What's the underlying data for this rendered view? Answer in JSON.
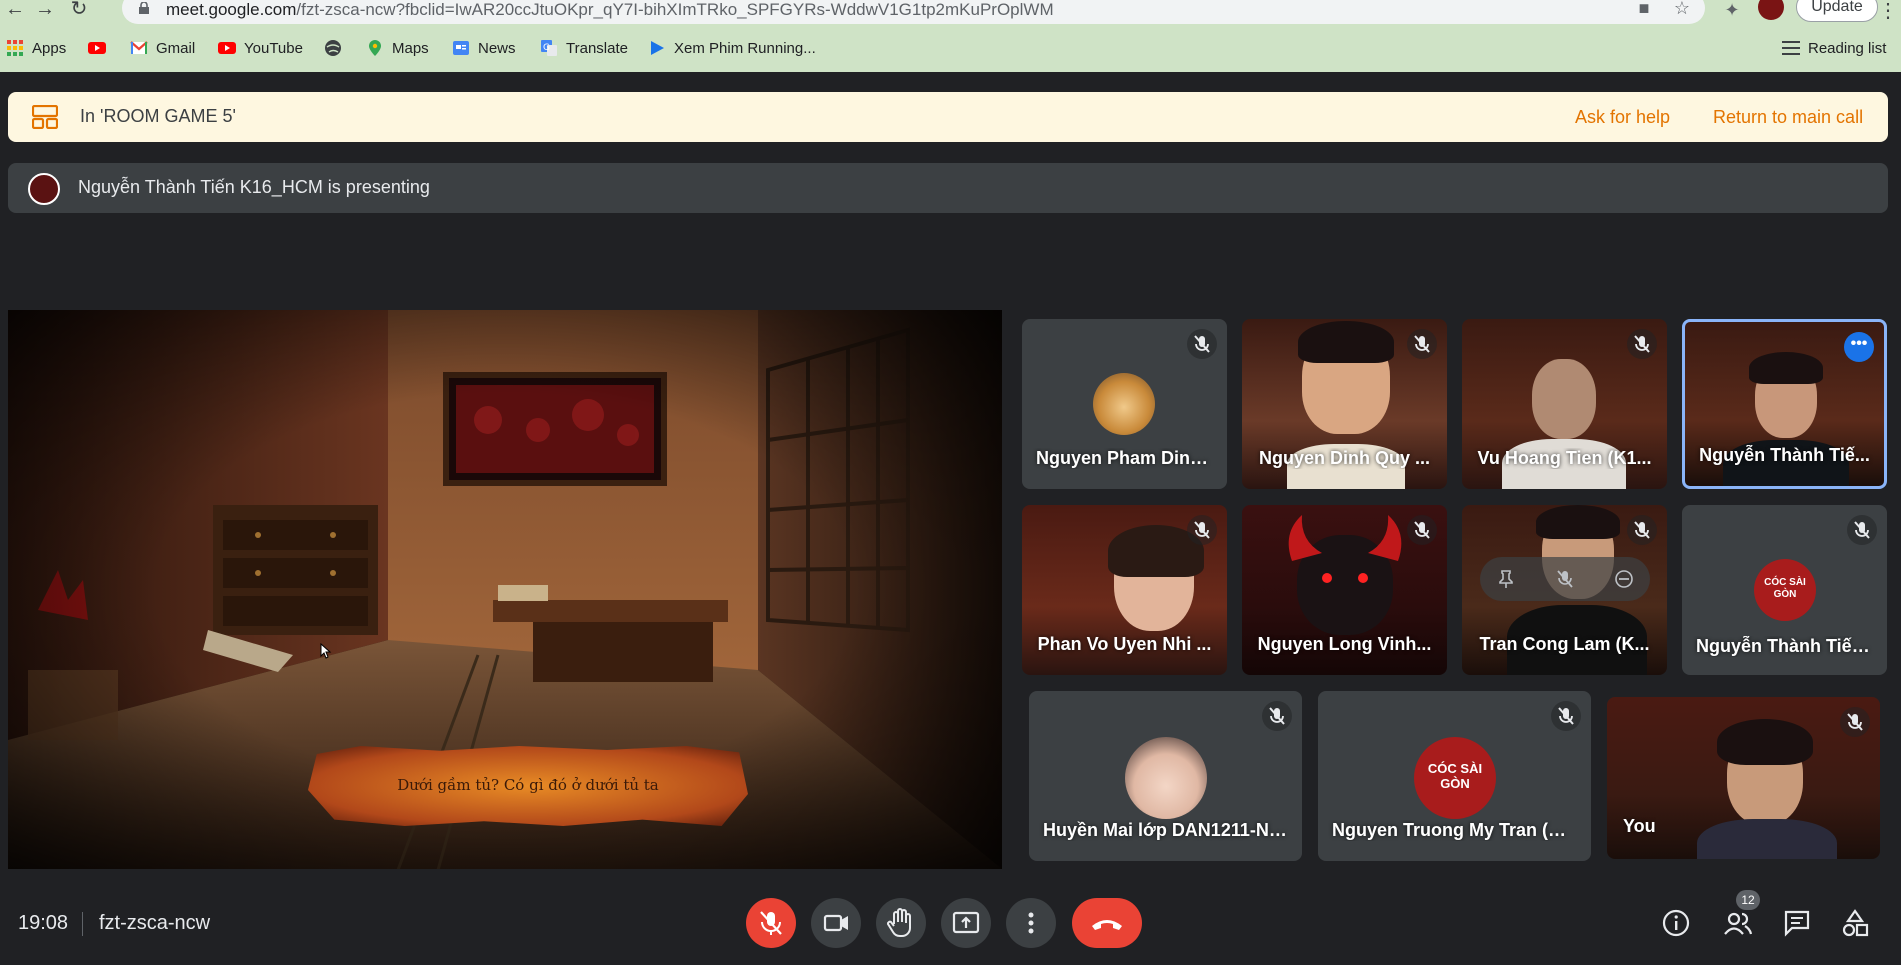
{
  "browser": {
    "url_host": "meet.google.com",
    "url_path": "/fzt-zsca-ncw?fbclid=IwAR20ccJtuOKpr_qY7I-bihXImTRko_SPFGYRs-WddwV1G1tp2mKuPrOplWM",
    "update_label": "Update",
    "bookmarks": [
      {
        "label": "Apps",
        "icon": "apps-grid-icon",
        "color": "#ea4335"
      },
      {
        "label": "",
        "icon": "youtube-icon",
        "color": "#ff0000"
      },
      {
        "label": "Gmail",
        "icon": "gmail-icon",
        "color": "#ea4335"
      },
      {
        "label": "YouTube",
        "icon": "youtube-icon",
        "color": "#ff0000"
      },
      {
        "label": "",
        "icon": "globe-icon",
        "color": "#3c4043"
      },
      {
        "label": "Maps",
        "icon": "maps-pin-icon",
        "color": "#34a853"
      },
      {
        "label": "News",
        "icon": "news-icon",
        "color": "#4285f4"
      },
      {
        "label": "Translate",
        "icon": "translate-icon",
        "color": "#4285f4"
      },
      {
        "label": "Xem Phim Running...",
        "icon": "play-icon",
        "color": "#1a73e8"
      }
    ],
    "reading_list": "Reading list"
  },
  "breakout": {
    "room": "In 'ROOM GAME 5'",
    "ask_help": "Ask for help",
    "return_main": "Return to main call",
    "accent": "#e37400"
  },
  "presenting": {
    "text": "Nguyễn Thành Tiến K16_HCM is presenting"
  },
  "presentation": {
    "caption": "Dưới gầm tủ? Có gì đó ở dưới tủ ta"
  },
  "participants": [
    {
      "name": "Nguyen Pham Dinh ...",
      "type": "avatar",
      "muted": true
    },
    {
      "name": "Nguyen Dinh Quy ...",
      "type": "video",
      "muted": true
    },
    {
      "name": "Vu Hoang Tien (K1...",
      "type": "video",
      "muted": true
    },
    {
      "name": "Nguyễn Thành Tiế...",
      "type": "video",
      "muted": false,
      "active": true
    },
    {
      "name": "Phan Vo Uyen Nhi ...",
      "type": "video",
      "muted": true
    },
    {
      "name": "Nguyen Long Vinh...",
      "type": "video",
      "muted": true
    },
    {
      "name": "Tran Cong Lam (K...",
      "type": "video",
      "muted": true
    },
    {
      "name": "Nguyễn Thành Tiến...",
      "type": "avatar",
      "muted": true
    },
    {
      "name": "Huyền Mai lớp DAN1211-NH...",
      "type": "avatar",
      "muted": true
    },
    {
      "name": "Nguyen Truong My Tran (K1...",
      "type": "avatar",
      "muted": true
    },
    {
      "name": "You",
      "type": "video",
      "muted": true
    }
  ],
  "avatar_logo": "CÓC SÀI GÒN",
  "footer": {
    "time": "19:08",
    "meeting_code": "fzt-zsca-ncw",
    "people_count": "12"
  },
  "colors": {
    "hangup": "#ea4335",
    "mic_off": "#ea4335",
    "active_border": "#8ab4f8"
  }
}
